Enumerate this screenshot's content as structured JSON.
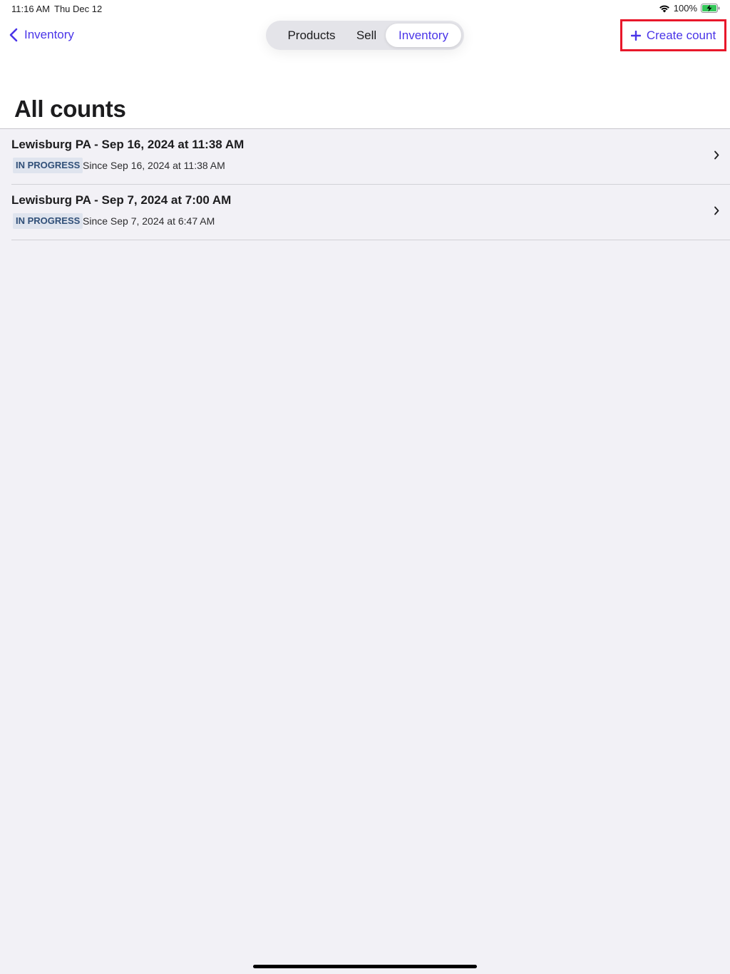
{
  "status_bar": {
    "time": "11:16 AM",
    "date": "Thu Dec 12",
    "battery_percent": "100%"
  },
  "nav": {
    "back_label": "Inventory",
    "segments": [
      "Products",
      "Sell",
      "Inventory"
    ],
    "selected_segment": "Inventory",
    "create_label": "Create count"
  },
  "page": {
    "title": "All counts"
  },
  "counts": [
    {
      "title": "Lewisburg PA - Sep 16, 2024 at 11:38 AM",
      "status": "IN PROGRESS",
      "since": "Since Sep 16, 2024 at 11:38 AM"
    },
    {
      "title": "Lewisburg PA - Sep 7, 2024 at 7:00 AM",
      "status": "IN PROGRESS",
      "since": "Since Sep 7, 2024 at 6:47 AM"
    }
  ],
  "colors": {
    "accent": "#4a35e8",
    "highlight_border": "#e8172a",
    "badge_bg": "#dfe4ee",
    "badge_text": "#304f78",
    "page_background": "#f2f1f6"
  },
  "icons": {
    "wifi": "wifi-icon",
    "battery": "battery-charging-icon",
    "back": "chevron-left-icon",
    "create": "plus-icon",
    "row": "chevron-right-icon"
  }
}
